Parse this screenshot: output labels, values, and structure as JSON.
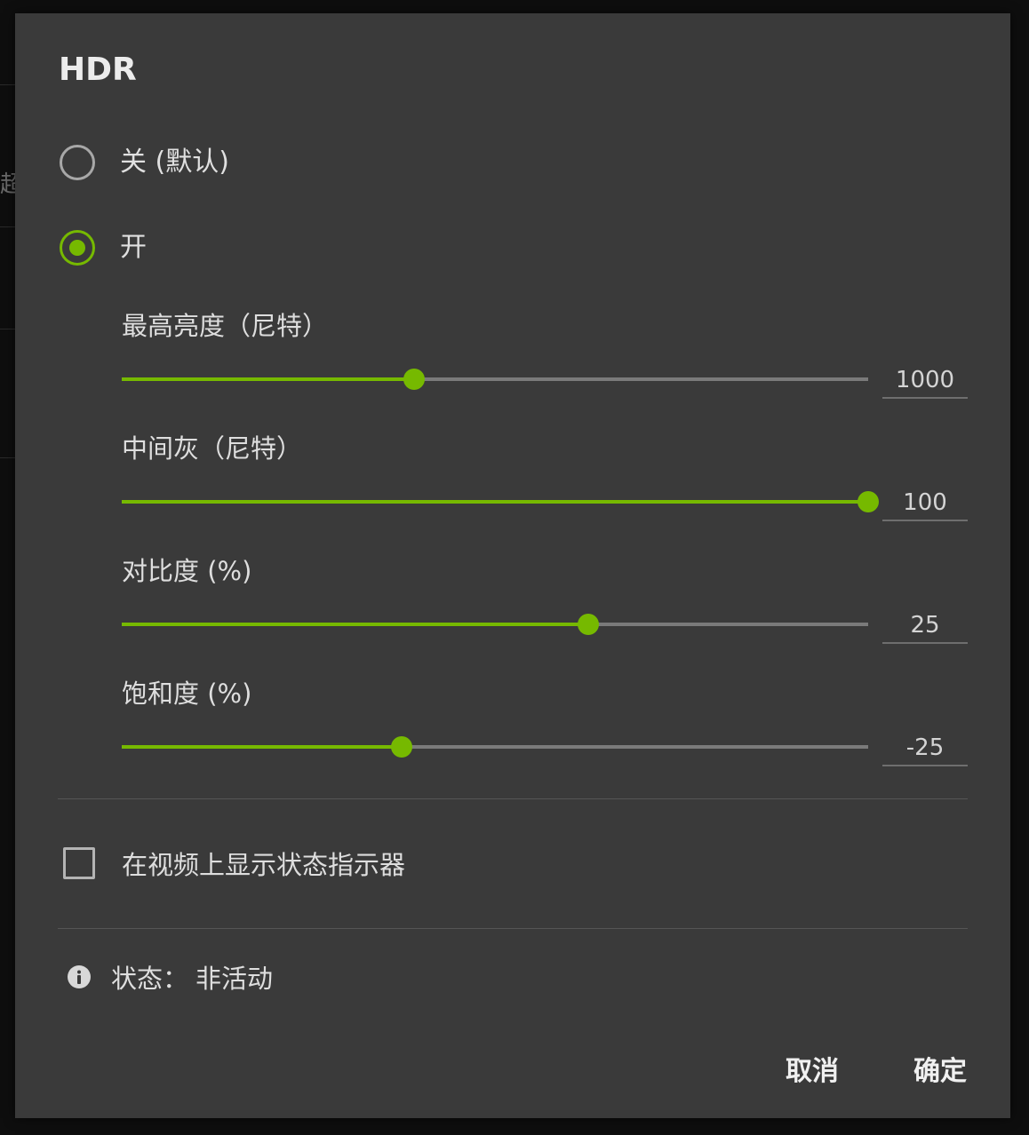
{
  "background": {
    "partial_text": "超分"
  },
  "dialog": {
    "title": "HDR",
    "accent_color": "#76b900",
    "options": [
      {
        "label": "关 (默认)",
        "selected": false
      },
      {
        "label": "开",
        "selected": true
      }
    ],
    "sliders": [
      {
        "label": "最高亮度（尼特）",
        "value": "1000",
        "position_fraction": 0.392
      },
      {
        "label": "中间灰（尼特）",
        "value": "100",
        "position_fraction": 1.0
      },
      {
        "label": "对比度 (%)",
        "value": "25",
        "position_fraction": 0.625
      },
      {
        "label": "饱和度 (%)",
        "value": "-25",
        "position_fraction": 0.375
      }
    ],
    "status_indicator": {
      "label": "在视频上显示状态指示器",
      "checked": false
    },
    "status": {
      "icon": "info-icon",
      "label": "状态：",
      "value": "非活动"
    },
    "buttons": {
      "cancel": "取消",
      "ok": "确定"
    }
  }
}
